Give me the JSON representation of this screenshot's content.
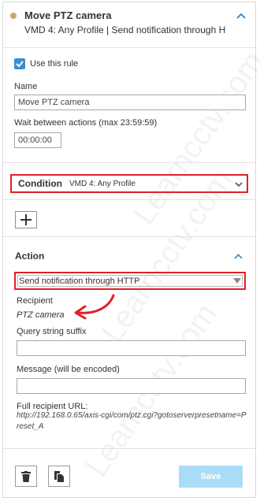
{
  "rule": {
    "title": "Move PTZ camera",
    "subtitle": "VMD 4: Any Profile | Send notification through H",
    "status_color": "#c8a96a"
  },
  "settings": {
    "use_rule_label": "Use this rule",
    "use_rule_checked": true,
    "name_label": "Name",
    "name_value": "Move PTZ camera",
    "wait_label": "Wait between actions (max 23:59:59)",
    "wait_value": "00:00:00"
  },
  "condition": {
    "title": "Condition",
    "value": "VMD 4: Any Profile"
  },
  "action": {
    "title": "Action",
    "type_value": "Send notification through HTTP",
    "recipient_label": "Recipient",
    "recipient_value": "PTZ camera",
    "query_label": "Query string suffix",
    "query_value": "",
    "message_label": "Message (will be encoded)",
    "message_value": "",
    "url_label": "Full recipient URL:",
    "url_value": "http://192.168.0.65/axis-cgi/com/ptz.cgi?gotoserverpresetname=Preset_A"
  },
  "footer": {
    "save_label": "Save"
  },
  "watermark": "Learncctv.com",
  "colors": {
    "accent": "#3a8fcf",
    "highlight": "#e0202a",
    "save_disabled": "#a9dcf7"
  }
}
